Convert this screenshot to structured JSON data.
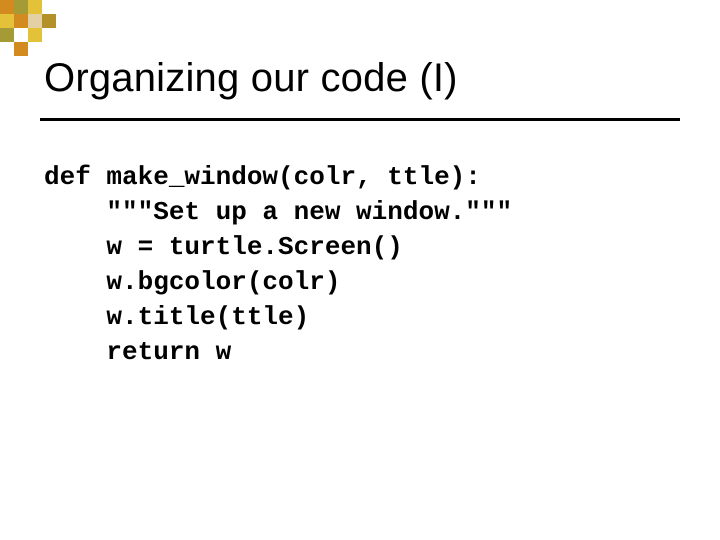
{
  "slide": {
    "title": "Organizing our code (I)",
    "code": {
      "l1": "def make_window(colr, ttle):",
      "l2": "    \"\"\"Set up a new window.\"\"\"",
      "l3": "    w = turtle.Screen()",
      "l4": "    w.bgcolor(colr)",
      "l5": "    w.title(ttle)",
      "l6": "    return w"
    },
    "decor": {
      "colors": {
        "orange": "#d38a1f",
        "olive": "#9a972f",
        "yellow": "#e3c23a",
        "tan": "#e3d1a5"
      }
    }
  }
}
